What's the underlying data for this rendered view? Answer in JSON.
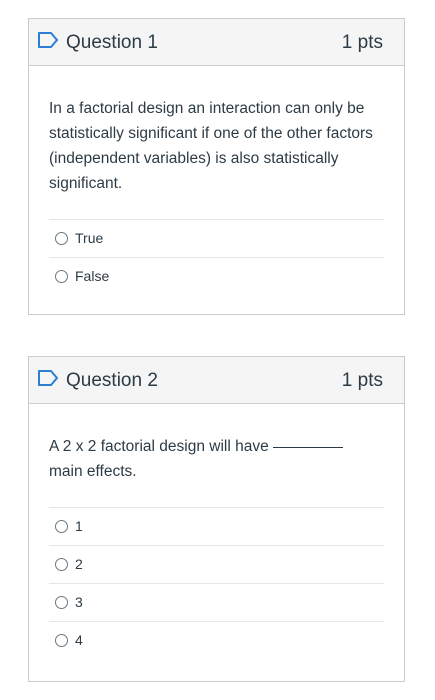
{
  "questions": [
    {
      "title": "Question 1",
      "points": "1 pts",
      "text": "In a factorial design an interaction can only be statistically significant if one of the other factors (independent variables) is also statistically significant.",
      "answers": [
        "True",
        "False"
      ]
    },
    {
      "title": "Question 2",
      "points": "1 pts",
      "text_before": "A 2 x 2 factorial design will have",
      "text_after": "main effects.",
      "answers": [
        "1",
        "2",
        "3",
        "4"
      ]
    }
  ],
  "colors": {
    "flag_blue": "#2d7dd2",
    "header_bg": "#f5f5f5",
    "border": "#c7cdd1",
    "text": "#2d3b45"
  }
}
